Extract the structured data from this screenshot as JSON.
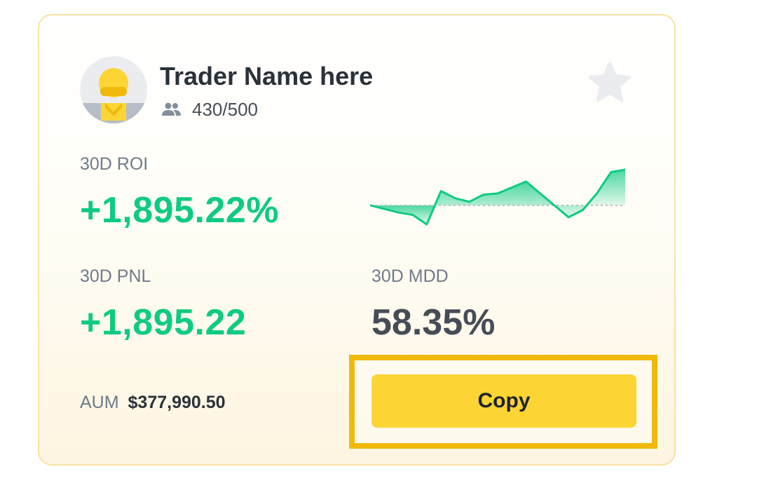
{
  "trader": {
    "name": "Trader Name here",
    "followers": "430/500",
    "followers_icon": "people-icon",
    "favorite_icon": "star-icon",
    "avatar_icon": "user-avatar-icon"
  },
  "stats": {
    "roi_label": "30D ROI",
    "roi_value": "+1,895.22%",
    "pnl_label": "30D PNL",
    "pnl_value": "+1,895.22",
    "mdd_label": "30D MDD",
    "mdd_value": "58.35%",
    "aum_label": "AUM",
    "aum_value": "$377,990.50"
  },
  "actions": {
    "copy_label": "Copy"
  },
  "colors": {
    "positive": "#0ecb81",
    "negative": "#f6465d",
    "brand_yellow": "#fcd535",
    "highlight": "#f0b90b",
    "star": "#eaecef"
  },
  "chart_data": {
    "type": "line",
    "baseline": 0,
    "values": [
      0.0,
      -0.3,
      -0.6,
      -0.8,
      -1.6,
      1.2,
      0.6,
      0.3,
      0.9,
      1.0,
      1.5,
      2.0,
      1.0,
      0.0,
      -1.0,
      -0.4,
      1.0,
      2.8,
      3.0
    ]
  }
}
